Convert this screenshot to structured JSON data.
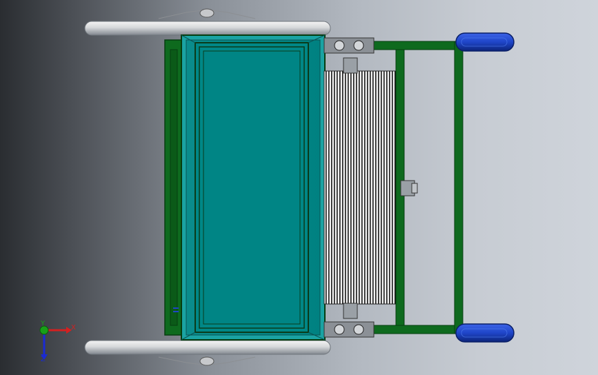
{
  "scene": {
    "kind": "cad-top-view",
    "colors": {
      "frame_green": "#0e6a1e",
      "frame_dark": "#063d10",
      "teal_panel": "#008787",
      "teal_border": "#1fa4a4",
      "roller_light": "#e9eaeb",
      "roller_dark": "#7a7f86",
      "grip_blue": "#1f45c8",
      "grip_dark": "#0c247a",
      "metal_grey": "#9aa0a6"
    },
    "icons": {
      "axis_triad": "xyz-triad-icon",
      "drum": "ribbed-drum-icon"
    }
  },
  "triad": {
    "x_label": "X",
    "y_label": "Y",
    "z_label": "Z",
    "x_color": "#d42020",
    "y_color": "#18a018",
    "z_color": "#1a2ad4"
  }
}
